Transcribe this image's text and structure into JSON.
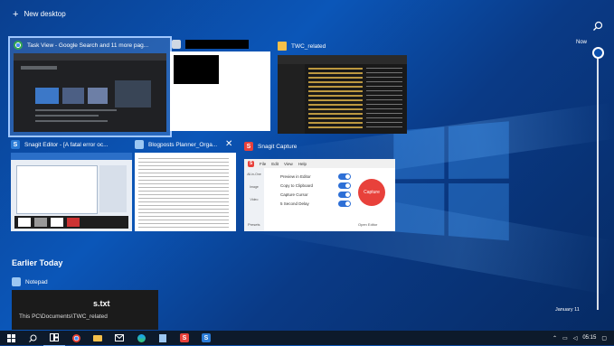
{
  "new_desktop_label": "New desktop",
  "windows": {
    "chrome": {
      "title": "Task View - Google Search and 11 more pag..."
    },
    "unknown": {
      "title": ""
    },
    "explorer": {
      "title": "TWC_related"
    },
    "snagit_editor": {
      "title": "Snagit Editor - [A fatal error oc..."
    },
    "notepad": {
      "title": "Blogposts Planner_Orga..."
    },
    "snagit_capture": {
      "title": "Snagit Capture",
      "menu": [
        "File",
        "Edit",
        "View",
        "Help"
      ],
      "options": [
        "Preview in Editor",
        "Copy to Clipboard",
        "Capture Cursor",
        "5 Second Delay"
      ],
      "capture_label": "Capture",
      "sidebar": [
        "All-in-One",
        "Image",
        "Video"
      ],
      "presets_label": "Presets",
      "open_editor_label": "Open Editor"
    }
  },
  "earlier_today": {
    "title": "Earlier Today",
    "app_name": "Notepad",
    "file_fragment": "s.txt",
    "path": "This PC\\Documents\\TWC_related"
  },
  "timeline": {
    "now_label": "Now",
    "date_label": "January 11"
  },
  "taskbar": {
    "clock": "05:15"
  },
  "colors": {
    "accent": "#0b56b8",
    "snagit_red": "#e8413b",
    "taskbar": "#0d1a2b"
  },
  "icons": [
    "windows-start-icon",
    "task-view-icon",
    "chrome-icon",
    "file-explorer-icon",
    "mail-icon",
    "edge-icon",
    "notepad-icon",
    "snagit-icon",
    "search-icon"
  ]
}
